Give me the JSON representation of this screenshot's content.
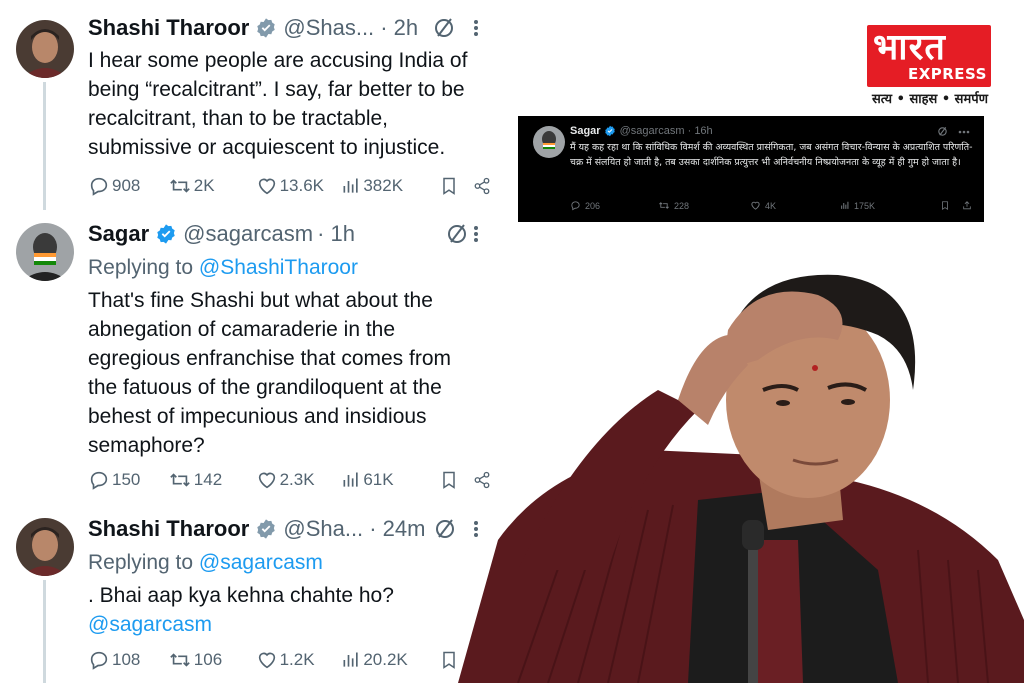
{
  "tweets": [
    {
      "name": "Shashi Tharoor",
      "handle": "@Shas...",
      "time": "· 2h",
      "text": "I hear some people are accusing India of being “recalcitrant”. I say, far better to be recalcitrant, than to be tractable, submissive or acquiescent to injustice.",
      "stats": {
        "replies": "908",
        "retweets": "2K",
        "likes": "13.6K",
        "views": "382K"
      }
    },
    {
      "name": "Sagar",
      "handle": "@sagarcasm",
      "time": "· 1h",
      "replying_prefix": "Replying to ",
      "replying_to": "@ShashiTharoor",
      "text": "That's fine Shashi but what about the abnegation of camaraderie in the egregious enfranchise that comes from the fatuous of the grandiloquent at the behest of impecunious and insidious semaphore?",
      "stats": {
        "replies": "150",
        "retweets": "142",
        "likes": "2.3K",
        "views": "61K"
      }
    },
    {
      "name": "Shashi Tharoor",
      "handle": "@Sha...",
      "time": "· 24m",
      "replying_prefix": "Replying to ",
      "replying_to": "@sagarcasm",
      "text": ". Bhai aap kya kehna chahte ho?",
      "mention": "@sagarcasm",
      "stats": {
        "replies": "108",
        "retweets": "106",
        "likes": "1.2K",
        "views": "20.2K"
      }
    }
  ],
  "logo": {
    "brand_hindi": "भारत",
    "brand_en": "EXPRESS",
    "tagline": "सत्य • साहस • समर्पण",
    "color": "#e51d25"
  },
  "screenshot_tweet": {
    "name": "Sagar",
    "handle": "@sagarcasm · 16h",
    "text": "मैं यह कह रहा था कि सांविधिक विमर्श की अव्यवस्थित प्रासंगिकता, जब असंगत विचार-विन्यास के अप्रत्याशित परिणति-चक्र में संलयित हो जाती है, तब उसका दार्शनिक प्रत्युत्तर भी अनिर्वचनीय निष्प्रयोजनता के व्यूह में ही गुम हो जाता है।",
    "stats": {
      "replies": "206",
      "retweets": "228",
      "likes": "4K",
      "views": "175K"
    }
  },
  "colors": {
    "link": "#1d9bf0",
    "verified": "#1d9bf0",
    "grey_verified": "#829aab",
    "muted": "#536471"
  }
}
